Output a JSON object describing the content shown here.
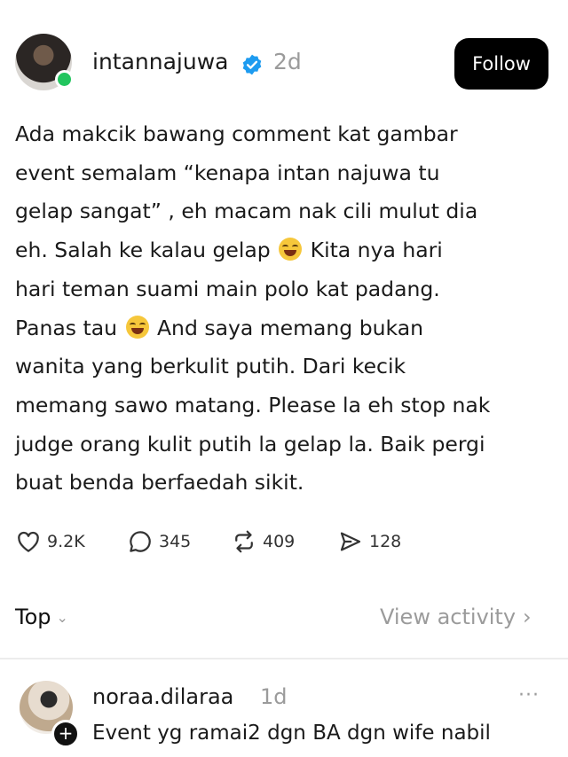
{
  "post": {
    "username": "intannajuwa",
    "age": "2d",
    "follow_label": "Follow",
    "lines": [
      {
        "pre": "Ada makcik bawang comment kat gambar",
        "emoji": false,
        "post": ""
      },
      {
        "pre": "event semalam “kenapa intan najuwa tu",
        "emoji": false,
        "post": ""
      },
      {
        "pre": "gelap sangat” , eh macam nak cili mulut dia",
        "emoji": false,
        "post": ""
      },
      {
        "pre": "eh. Salah ke kalau gelap ",
        "emoji": true,
        "post": " Kita nya hari"
      },
      {
        "pre": "hari teman suami main polo kat padang.",
        "emoji": false,
        "post": ""
      },
      {
        "pre": "Panas tau ",
        "emoji": true,
        "post": " And saya memang bukan"
      },
      {
        "pre": "wanita yang berkulit putih. Dari kecik",
        "emoji": false,
        "post": ""
      },
      {
        "pre": "memang sawo matang. Please la eh stop nak",
        "emoji": false,
        "post": ""
      },
      {
        "pre": "judge orang kulit putih la gelap la. Baik pergi",
        "emoji": false,
        "post": ""
      },
      {
        "pre": "buat benda berfaedah sikit.",
        "emoji": false,
        "post": ""
      }
    ],
    "emoji_name": "face-with-tears-of-joy-emoji",
    "stats": {
      "likes": "9.2K",
      "comments": "345",
      "reposts": "409",
      "shares": "128"
    }
  },
  "filter": {
    "sort_label": "Top",
    "view_activity_label": "View activity"
  },
  "reply": {
    "username": "noraa.dilaraa",
    "age": "1d",
    "more_label": "···",
    "text": "Event yg ramai2 dgn BA dgn wife nabil"
  },
  "colors": {
    "accent_verified": "#1d9bf0",
    "online": "#22c55e",
    "muted": "#9b9b9b"
  }
}
